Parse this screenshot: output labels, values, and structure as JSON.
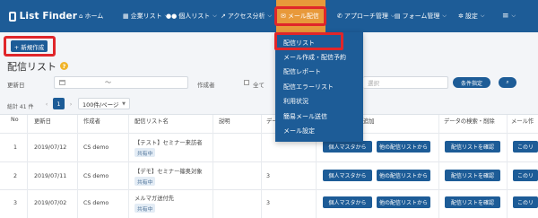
{
  "brand": {
    "name": "List Finder"
  },
  "nav": {
    "home": "ホーム",
    "companies": "企業リスト",
    "people": "個人リスト",
    "access": "アクセス分析",
    "mail": "メール配信",
    "approach": "アプローチ管理",
    "forms": "フォーム管理",
    "settings": "設定"
  },
  "mail_menu": [
    "配信リスト",
    "メール作成・配信予約",
    "配信レポート",
    "配信エラーリスト",
    "利用状況",
    "簡易メール送信",
    "メール設定"
  ],
  "toolbar": {
    "new_label": "+ 新規作成"
  },
  "page": {
    "title": "配信リスト"
  },
  "filters": {
    "updated_label": "更新日",
    "date_sep": "〜",
    "creator_label": "作成者",
    "all_label": "全て",
    "select_placeholder": "選択",
    "condition_button": "条件指定",
    "search_icon": "search-icon"
  },
  "pagination": {
    "total": "総計 41 件",
    "current": "1",
    "per_page": "100件/ページ"
  },
  "table": {
    "headers": [
      "No",
      "更新日",
      "作成者",
      "配信リスト名",
      "説明",
      "データ",
      "追加",
      "データの検索・削除",
      "メール作"
    ],
    "rows": [
      {
        "no": "1",
        "date": "2019/07/12",
        "creator": "CS demo",
        "name": "【テスト】セミナー来訪者",
        "badge": "共有中",
        "count": ""
      },
      {
        "no": "2",
        "date": "2019/07/11",
        "creator": "CS demo",
        "name": "【デモ】セミナー篠奥対象",
        "badge": "共有中",
        "count": "3"
      },
      {
        "no": "3",
        "date": "2019/07/02",
        "creator": "CS demo",
        "name": "メルマガ送付先",
        "badge": "共有中",
        "count": "3"
      }
    ],
    "btn_master": "個人マスタから",
    "btn_other": "他の配信リストから",
    "btn_confirm": "配信リストを確認",
    "btn_mail": "このリ"
  }
}
